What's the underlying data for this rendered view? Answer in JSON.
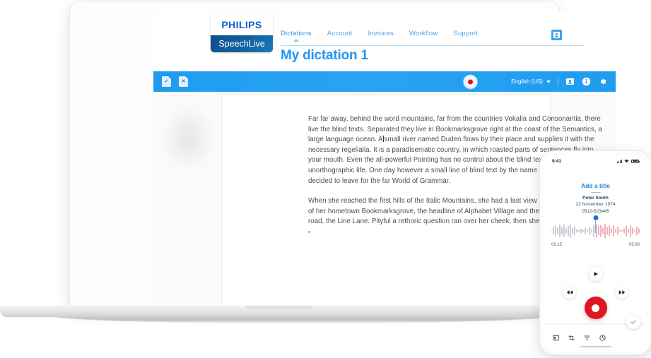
{
  "brand": {
    "logo_top": "PHILIPS",
    "logo_bottom": "SpeechLive"
  },
  "header": {
    "nav": [
      {
        "label": "Dictations",
        "active": true
      },
      {
        "label": "Account",
        "active": false
      },
      {
        "label": "Invoices",
        "active": false
      },
      {
        "label": "Workflow",
        "active": false
      },
      {
        "label": "Support",
        "active": false
      }
    ],
    "account_icon": "user-account-icon",
    "page_title": "My dictation 1"
  },
  "toolbar": {
    "doc_accept_icon": "document-accept-icon",
    "doc_reject_icon": "document-reject-icon",
    "record_icon": "record-icon",
    "language": "English (US)",
    "caret_icon": "chevron-down-icon",
    "contact_icon": "contact-card-icon",
    "info_icon": "info-icon",
    "settings_icon": "gear-icon"
  },
  "document": {
    "paragraph_1_a": "Far far away, behind the word mountains, far from the countries Vokalia and Consonantia, there live the blind texts. Separated they live in Bookmarksgrove right at the coast of the Semantics, a large language ocean. A",
    "paragraph_1_b": "small river named Duden flows by their place and supplies it with the necessary regelialia. It is a paradisematic country, in which roasted parts of sentences fly into your mouth. Even the all-powerful Pointing has no control about the blind texts it is an almost unorthographic life. One day however a small line of blind text by the name of Lorem Ipsum decided to leave for the far World of Grammar.",
    "paragraph_2": "When she reached the first hills of the Italic Mountains, she had a last view back on the skyline of her hometown Bookmarksgrove, the headline of Alphabet Village and the subline of her own road, the Line Lane. Pityful a rethoric question ran over her cheek, then she continued her way.",
    "trailing_marker": "▪··"
  },
  "phone": {
    "status_time": "9:41",
    "signal_icon": "signal-bars-icon",
    "wifi_icon": "wifi-icon",
    "battery_icon": "battery-icon",
    "title": "Add a title",
    "author": "Peter Smith",
    "date": "22 November 1974",
    "reference": "0512-523445",
    "time_elapsed": "02:15",
    "time_total": "05:30",
    "play_icon": "play-icon",
    "rewind_icon": "rewind-icon",
    "forward_icon": "fast-forward-icon",
    "record_icon": "record-icon",
    "bottom_icons": [
      "keyboard-icon",
      "crop-icon",
      "priority-icon",
      "clock-icon"
    ],
    "confirm_icon": "check-icon"
  },
  "colors": {
    "brand_blue": "#0b5ed7",
    "accent_blue": "#2196f3",
    "toolbar_blue": "#1f9cf0",
    "record_red": "#dc1823",
    "waveform_red": "#e8707f",
    "waveform_grey": "#9aa3ad"
  }
}
